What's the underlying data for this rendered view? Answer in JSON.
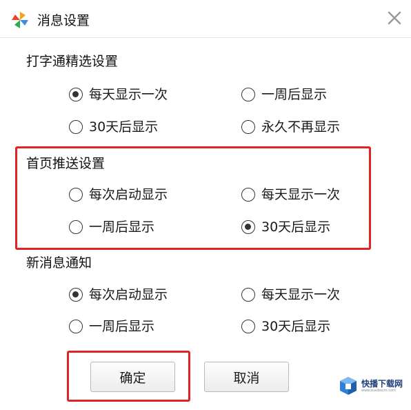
{
  "window": {
    "title": "消息设置",
    "icon": "pinwheel-app-icon",
    "close_icon": "close-x-icon"
  },
  "sections": [
    {
      "title": "打字通精选设置",
      "options": [
        {
          "label": "每天显示一次",
          "checked": true
        },
        {
          "label": "一周后显示",
          "checked": false
        },
        {
          "label": "30天后显示",
          "checked": false
        },
        {
          "label": "永久不再显示",
          "checked": false
        }
      ]
    },
    {
      "title": "首页推送设置",
      "highlighted": true,
      "options": [
        {
          "label": "每次启动显示",
          "checked": false
        },
        {
          "label": "每天显示一次",
          "checked": false
        },
        {
          "label": "一周后显示",
          "checked": false
        },
        {
          "label": "30天后显示",
          "checked": true
        }
      ]
    },
    {
      "title": "新消息通知",
      "options": [
        {
          "label": "每次启动显示",
          "checked": true
        },
        {
          "label": "每天显示一次",
          "checked": false
        },
        {
          "label": "一周后显示",
          "checked": false
        },
        {
          "label": "30天后显示",
          "checked": false
        }
      ]
    }
  ],
  "buttons": {
    "confirm_label": "确定",
    "cancel_label": "取消",
    "confirm_highlighted": true
  },
  "watermark": {
    "text": "快播下载网",
    "subtext": "www.kuaibocm.com",
    "icon": "cube-logo-icon"
  },
  "colors": {
    "highlight": "#e02424",
    "radio": "#333333"
  }
}
